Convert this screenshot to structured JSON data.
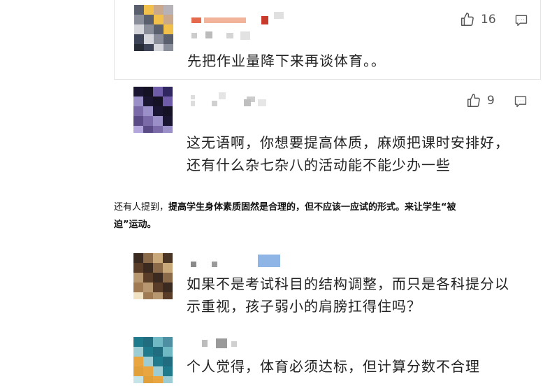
{
  "comments": [
    {
      "text": "先把作业量降下来再谈体育。。",
      "likes": "16",
      "avatar_colors": [
        "#5a5f6e",
        "#a8a1a3",
        "#c9a88c",
        "#3d4458",
        "#e3c9a8",
        "#8a8d9a",
        "#5a6fa0",
        "#f0c04a",
        "#272b36",
        "#b7b1b8",
        "#d4d6dc",
        "#7b7f90"
      ],
      "name_colors": [
        "#e36a4c",
        "#f2b39b",
        "#c73a2c",
        "#d9d9d9"
      ]
    },
    {
      "line1": "这无语啊，你想要提高体质，麻烦把课时安排好，",
      "line2": "还有什么杂七杂八的活动能不能少办一些",
      "likes": "9",
      "avatar_colors": [
        "#1a1530",
        "#3c2d6b",
        "#6f5ca8",
        "#5a4a86",
        "#2d2450",
        "#9b8fc7",
        "#4d3f80",
        "#161226",
        "#b3a6dc",
        "#302760",
        "#7a6aa8",
        "#211b3d"
      ]
    },
    {
      "line1": "如果不是考试科目的结构调整，而只是各科提分以",
      "line2": "示重视，孩子弱小的肩膀扛得住吗？",
      "avatar_colors": [
        "#3a2a20",
        "#6b4a2e",
        "#c9a97a",
        "#a07a52",
        "#e7d3a8",
        "#5a3d28",
        "#d6b98a",
        "#8a6a48",
        "#f0e2c2",
        "#4a3524",
        "#b89870",
        "#eadbb8"
      ]
    },
    {
      "text": "个人觉得，体育必须达标，但计算分数不合理",
      "avatar_colors": [
        "#1f7a8c",
        "#2f98ab",
        "#6fb8c4",
        "#e2a03a",
        "#3f5f75",
        "#9ccdd5",
        "#f1b54a",
        "#216c7e",
        "#c6e3e8",
        "#4f8fa3",
        "#e8a540",
        "#7fb2c0"
      ]
    }
  ],
  "article": {
    "prefix": "还有人提到，",
    "bold1": "提高学生身体素质固然是合理的，但不应该一应试的形式。来让学生“被",
    "bold2": "迫”运动。"
  },
  "icons": {
    "like": "thumbs-up-icon",
    "reply": "comment-icon"
  }
}
